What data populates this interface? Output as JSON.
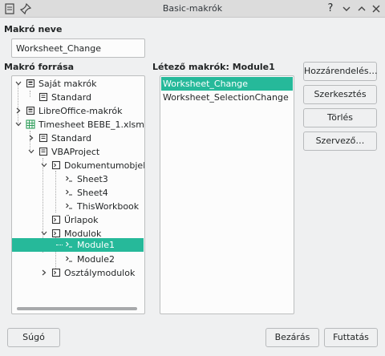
{
  "window": {
    "title": "Basic-makrók",
    "help_button": "?"
  },
  "macro_name": {
    "label": "Makró neve",
    "value": "Worksheet_Change"
  },
  "macro_source": {
    "label": "Makró forrása",
    "tree": [
      {
        "label": "Saját makrók",
        "icon": "container-icon",
        "expanded": true
      },
      {
        "label": "Standard",
        "icon": "basic-library-icon"
      },
      {
        "label": "LibreOffice-makrók",
        "icon": "container-icon",
        "expanded": false
      },
      {
        "label": "Timesheet BEBE_1.xlsm",
        "icon": "spreadsheet-icon",
        "expanded": true
      },
      {
        "label": "Standard",
        "icon": "basic-library-icon",
        "expanded": false
      },
      {
        "label": "VBAProject",
        "icon": "basic-library-icon",
        "expanded": true
      },
      {
        "label": "Dokumentumobjektumok",
        "icon": "module-icon",
        "expanded": true
      },
      {
        "label": "Sheet3",
        "icon": "module-icon"
      },
      {
        "label": "Sheet4",
        "icon": "module-icon"
      },
      {
        "label": "ThisWorkbook",
        "icon": "module-icon"
      },
      {
        "label": "Űrlapok",
        "icon": "module-icon"
      },
      {
        "label": "Modulok",
        "icon": "module-icon",
        "expanded": true
      },
      {
        "label": "Module1",
        "icon": "module-icon",
        "selected": true
      },
      {
        "label": "Module2",
        "icon": "module-icon"
      },
      {
        "label": "Osztálymodulok",
        "icon": "module-icon",
        "expanded": false
      }
    ]
  },
  "existing_macros": {
    "label": "Létező makrók: Module1",
    "items": [
      {
        "label": "Worksheet_Change",
        "selected": true
      },
      {
        "label": "Worksheet_SelectionChange"
      }
    ]
  },
  "buttons": {
    "assign": "Hozzárendelés…",
    "edit": "Szerkesztés",
    "delete": "Törlés",
    "organizer": "Szervező…",
    "help": "Súgó",
    "close": "Bezárás",
    "run": "Futtatás"
  },
  "colors": {
    "selection": "#26b99a",
    "window_bg": "#eff0f1"
  }
}
